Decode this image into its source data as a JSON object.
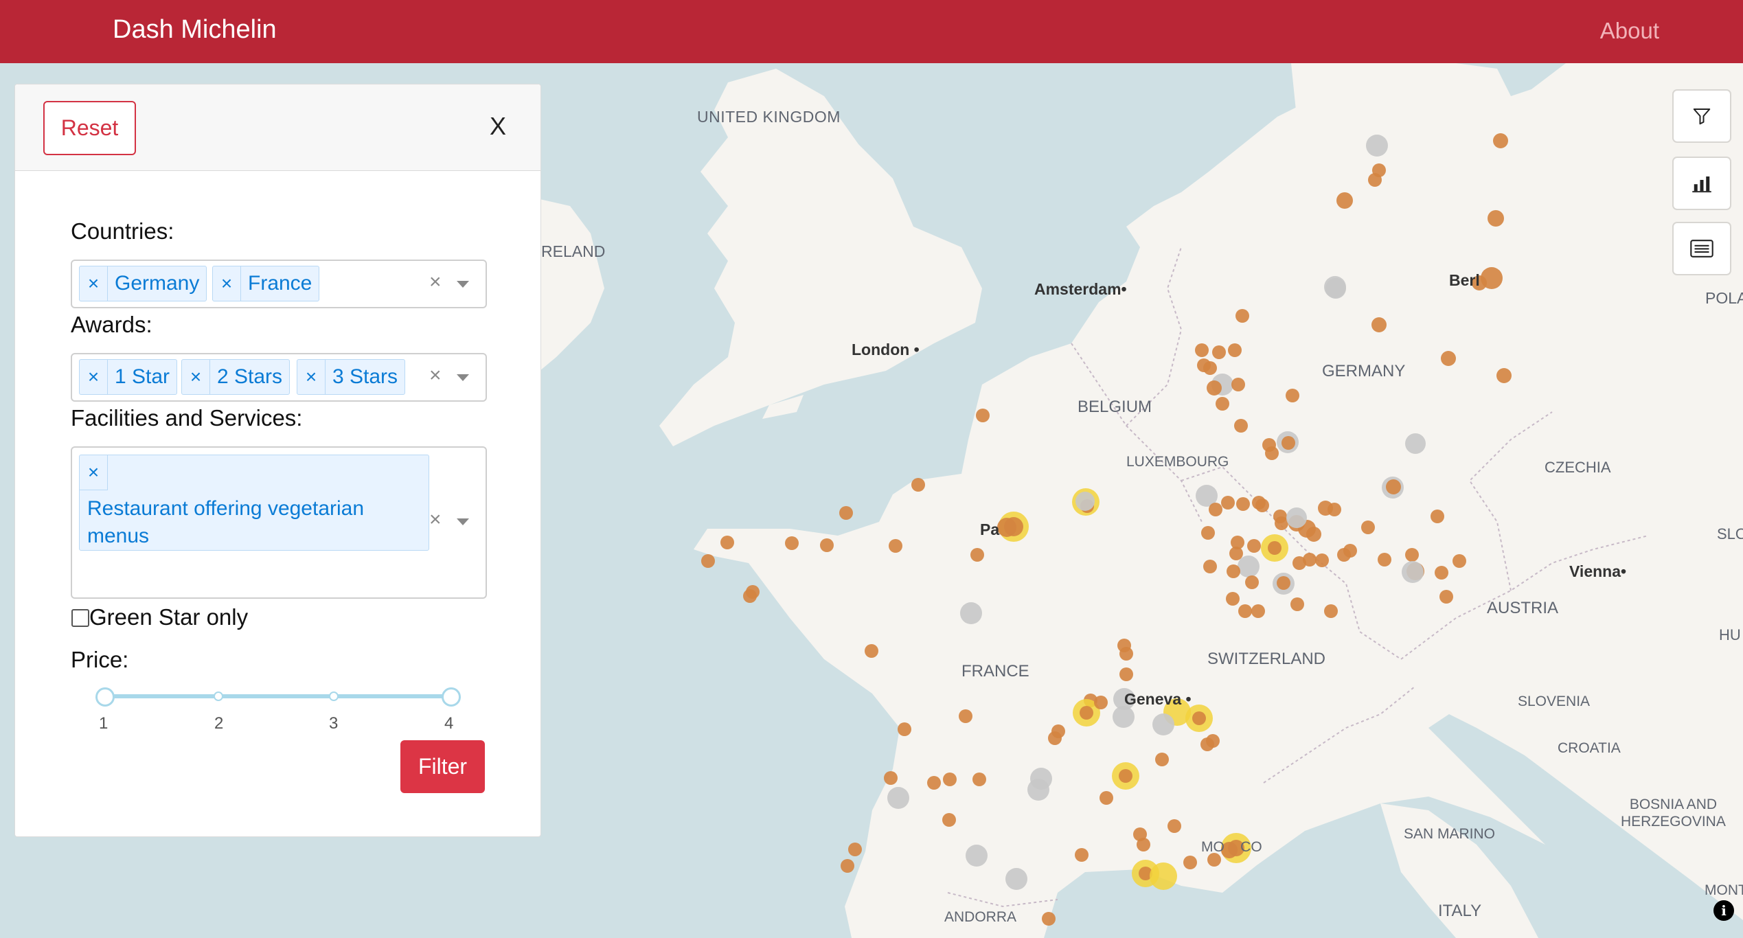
{
  "navbar": {
    "brand": "Dash Michelin",
    "about": "About"
  },
  "panel": {
    "reset_label": "Reset",
    "close_label": "X",
    "countries_label": "Countries:",
    "countries": [
      "Germany",
      "France"
    ],
    "awards_label": "Awards:",
    "awards": [
      "1 Star",
      "2 Stars",
      "3 Stars"
    ],
    "facilities_label": "Facilities and Services:",
    "facilities": [
      "Restaurant offering vegetarian menus"
    ],
    "facility_line1": "Restaurant offering vegetarian",
    "facility_line2": "menus",
    "green_star_label": "Green Star only",
    "green_star_checked": false,
    "price_label": "Price:",
    "price_ticks": [
      "1",
      "2",
      "3",
      "4"
    ],
    "price_range": [
      1,
      4
    ],
    "filter_label": "Filter"
  },
  "map_labels": {
    "united_kingdom": "UNITED KINGDOM",
    "ireland": "RELAND",
    "london": "London",
    "amsterdam": "Amsterdam",
    "belgium": "BELGIUM",
    "luxembourg": "LUXEMBOURG",
    "germany": "GERMANY",
    "berlin": "Berl",
    "poland": "POLA",
    "czechia": "CZECHIA",
    "paris": "Pa",
    "vienna": "Vienna",
    "austria": "AUSTRIA",
    "slovakia": "SLO",
    "hungary": "HU",
    "france": "FRANCE",
    "switzerland": "SWITZERLAND",
    "geneva": "Geneva",
    "slovenia": "SLOVENIA",
    "croatia": "CROATIA",
    "bosnia_1": "BOSNIA AND",
    "bosnia_2": "HERZEGOVINA",
    "san_marino": "SAN MARINO",
    "monaco": "MO    CO",
    "andorra": "ANDORRA",
    "italy": "ITALY",
    "montenegro": "MONT"
  },
  "colors": {
    "navbar": "#b92636",
    "one_star": "#d48440",
    "two_star": "#c8c8c8",
    "three_star": "#f2d23c",
    "water": "#cfe0e4",
    "land": "#f6f4f0"
  },
  "toolbar_icons": [
    "filter-icon",
    "bar-chart-icon",
    "list-icon"
  ]
}
